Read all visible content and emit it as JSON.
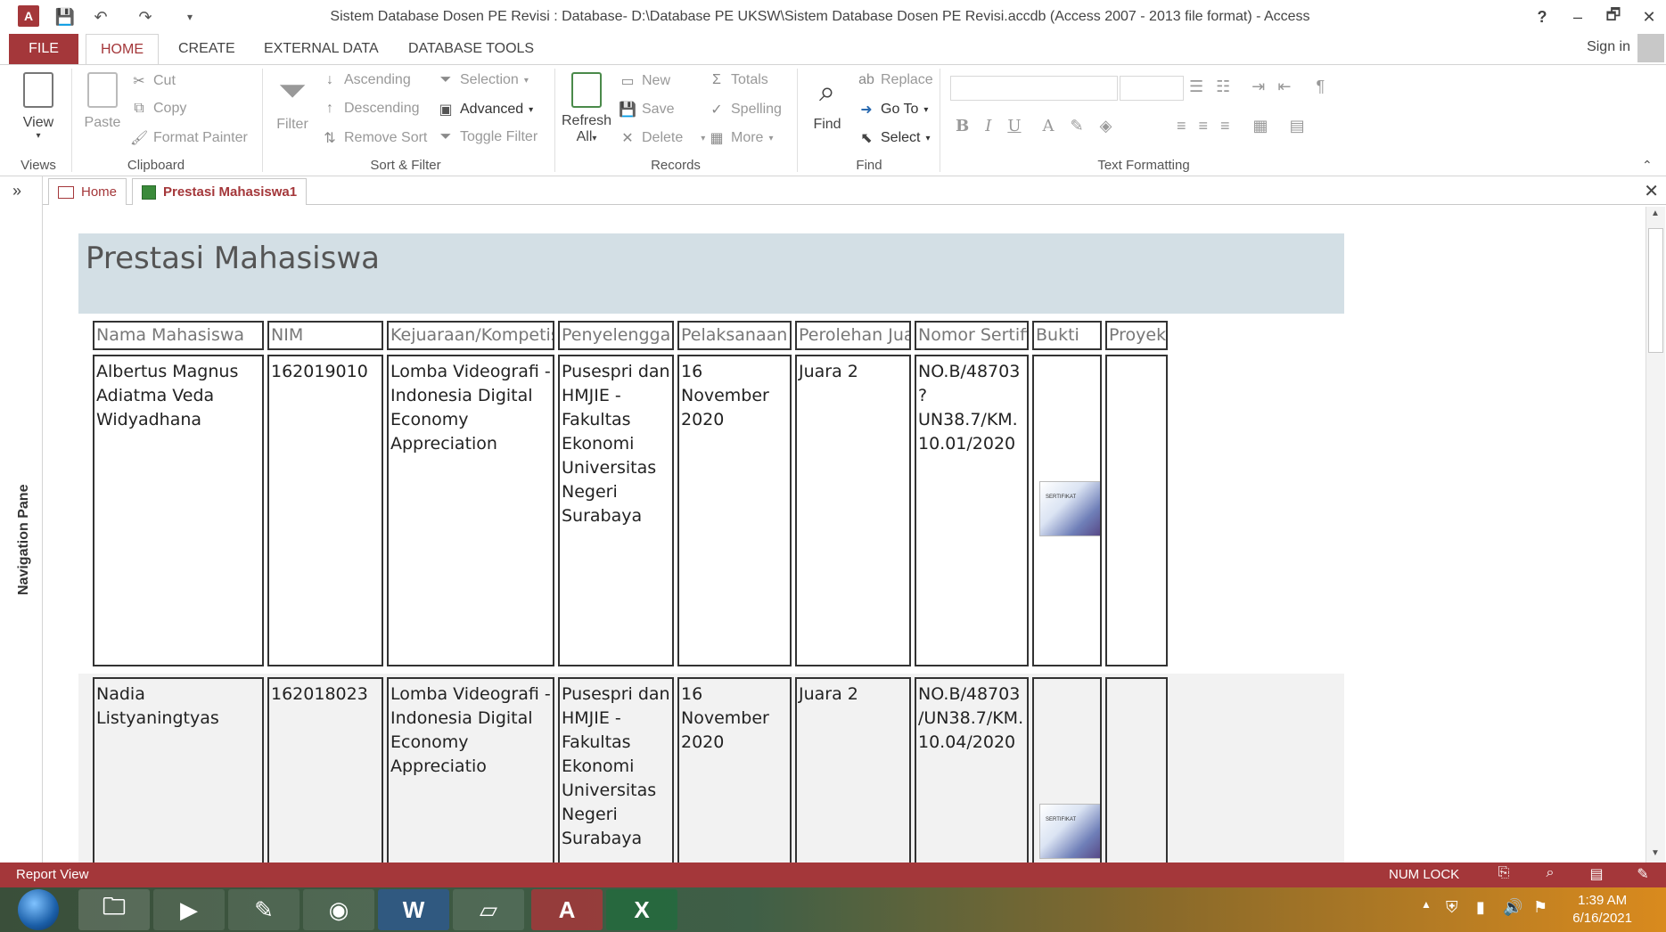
{
  "window": {
    "title": "Sistem Database Dosen PE Revisi : Database- D:\\Database PE UKSW\\Sistem Database Dosen PE Revisi.accdb (Access 2007 - 2013 file format) - Access",
    "help": "?",
    "minimize": "–",
    "restore": "🗗",
    "close": "✕"
  },
  "ribbon_tabs": [
    "FILE",
    "HOME",
    "CREATE",
    "EXTERNAL DATA",
    "DATABASE TOOLS"
  ],
  "signin": "Sign in",
  "ribbon": {
    "views": {
      "view": "View",
      "label": "Views"
    },
    "clipboard": {
      "paste": "Paste",
      "cut": "Cut",
      "copy": "Copy",
      "format_painter": "Format Painter",
      "label": "Clipboard"
    },
    "sort_filter": {
      "filter": "Filter",
      "ascending": "Ascending",
      "descending": "Descending",
      "remove_sort": "Remove Sort",
      "selection": "Selection",
      "advanced": "Advanced",
      "toggle_filter": "Toggle Filter",
      "label": "Sort & Filter"
    },
    "records": {
      "refresh": "Refresh",
      "refresh_all": "All",
      "new": "New",
      "save": "Save",
      "delete": "Delete",
      "totals": "Totals",
      "spelling": "Spelling",
      "more": "More",
      "label": "Records"
    },
    "find": {
      "find": "Find",
      "replace": "Replace",
      "goto": "Go To",
      "select": "Select",
      "label": "Find"
    },
    "text_formatting": {
      "label": "Text Formatting",
      "bold": "B",
      "italic": "I",
      "underline": "U",
      "font_color": "A"
    }
  },
  "nav_pane": {
    "label": "Navigation Pane",
    "toggle": "»"
  },
  "doc_tabs": [
    {
      "label": "Home",
      "active": false
    },
    {
      "label": "Prestasi Mahasiswa1",
      "active": true
    }
  ],
  "doc_close": "✕",
  "report": {
    "title": "Prestasi Mahasiswa",
    "headers": [
      "Nama Mahasiswa",
      "NIM",
      "Kejuaraan/Kompetisi",
      "Penyelenggara",
      "Pelaksanaan",
      "Perolehan Juara",
      "Nomor Sertifika",
      "Bukti",
      "Proyek"
    ],
    "rows": [
      {
        "nama": "Albertus Magnus Adiatma Veda Widyadhana",
        "nim": "162019010",
        "kejuaraan": "Lomba Videografi - Indonesia Digital Economy Appreciation",
        "penyelenggara": "Pusespri dan HMJIE - Fakultas Ekonomi Universitas Negeri Surabaya",
        "pelaksanaan": "16 November 2020",
        "juara": "Juara 2",
        "sertifikat": "NO.B/48703?UN38.7/KM.10.01/2020",
        "bukti": "SERTIFIKAT",
        "proyek": ""
      },
      {
        "nama": "Nadia Listyaningtyas",
        "nim": "162018023",
        "kejuaraan": "Lomba Videografi - Indonesia Digital Economy Appreciatio",
        "penyelenggara": "Pusespri dan HMJIE - Fakultas Ekonomi Universitas Negeri Surabaya",
        "pelaksanaan": "16 November 2020",
        "juara": "Juara 2",
        "sertifikat": "NO.B/48703/UN38.7/KM.10.04/2020",
        "bukti": "SERTIFIKAT",
        "proyek": ""
      }
    ]
  },
  "status_bar": {
    "view": "Report View",
    "numlock": "NUM LOCK"
  },
  "taskbar": {
    "time": "1:39 AM",
    "date": "6/16/2021"
  },
  "colors": {
    "accent": "#a4373a",
    "header_band": "#d3dfe5"
  }
}
